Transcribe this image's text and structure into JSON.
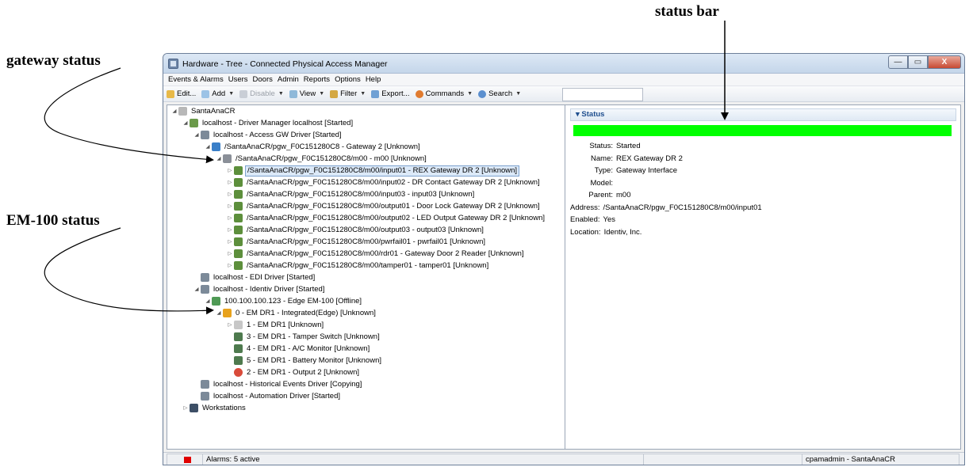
{
  "annotations": {
    "status_bar": "status bar",
    "gateway_status": "gateway status",
    "em100_status": "EM-100 status"
  },
  "window": {
    "title": "Hardware - Tree - Connected Physical Access Manager",
    "controls": [
      "—",
      "▭",
      "X"
    ]
  },
  "menu": [
    "Events & Alarms",
    "Users",
    "Doors",
    "Admin",
    "Reports",
    "Options",
    "Help"
  ],
  "toolbar": {
    "edit": "Edit...",
    "add": "Add",
    "disable": "Disable",
    "view": "View",
    "filter": "Filter",
    "export": "Export...",
    "commands": "Commands",
    "search": "Search"
  },
  "tree": [
    "SantaAnaCR",
    "localhost - Driver Manager localhost [Started]",
    "localhost - Access GW Driver [Started]",
    "/SantaAnaCR/pgw_F0C151280C8 - Gateway  2 [Unknown]",
    "/SantaAnaCR/pgw_F0C151280C8/m00 - m00 [Unknown]",
    "/SantaAnaCR/pgw_F0C151280C8/m00/input01 - REX Gateway DR 2 [Unknown]",
    "/SantaAnaCR/pgw_F0C151280C8/m00/input02 - DR Contact Gateway DR 2 [Unknown]",
    "/SantaAnaCR/pgw_F0C151280C8/m00/input03 - input03 [Unknown]",
    "/SantaAnaCR/pgw_F0C151280C8/m00/output01 - Door Lock Gateway DR 2 [Unknown]",
    "/SantaAnaCR/pgw_F0C151280C8/m00/output02 - LED Output Gateway DR 2 [Unknown]",
    "/SantaAnaCR/pgw_F0C151280C8/m00/output03 - output03 [Unknown]",
    "/SantaAnaCR/pgw_F0C151280C8/m00/pwrfail01 - pwrfail01 [Unknown]",
    "/SantaAnaCR/pgw_F0C151280C8/m00/rdr01 - Gateway Door 2 Reader [Unknown]",
    "/SantaAnaCR/pgw_F0C151280C8/m00/tamper01 - tamper01 [Unknown]",
    "localhost - EDI Driver [Started]",
    "localhost - Identiv Driver [Started]",
    "100.100.100.123 - Edge EM-100  [Offline]",
    "0 - EM DR1 - Integrated(Edge) [Unknown]",
    "1 - EM DR1 [Unknown]",
    "3 - EM DR1 - Tamper Switch [Unknown]",
    "4 - EM DR1 - A/C Monitor [Unknown]",
    "5 - EM DR1 - Battery Monitor [Unknown]",
    "2 - EM DR1 - Output 2 [Unknown]",
    "localhost - Historical Events Driver [Copying]",
    "localhost - Automation Driver [Started]",
    "Workstations"
  ],
  "status_panel": {
    "header": "Status",
    "bar_color": "#00ff00",
    "status_label": "Status:",
    "status_value": "Started",
    "name_label": "Name:",
    "name_value": "REX Gateway DR 2",
    "type_label": "Type:",
    "type_value": "Gateway Interface",
    "model_label": "Model:",
    "model_value": "",
    "parent_label": "Parent:",
    "parent_value": "m00",
    "address_label": "Address:",
    "address_value": "/SantaAnaCR/pgw_F0C151280C8/m00/input01",
    "enabled_label": "Enabled:",
    "enabled_value": "Yes",
    "location_label": "Location:",
    "location_value": "Identiv, Inc."
  },
  "statusbar": {
    "alarms": "Alarms: 5 active",
    "user": "cpamadmin - SantaAnaCR"
  }
}
